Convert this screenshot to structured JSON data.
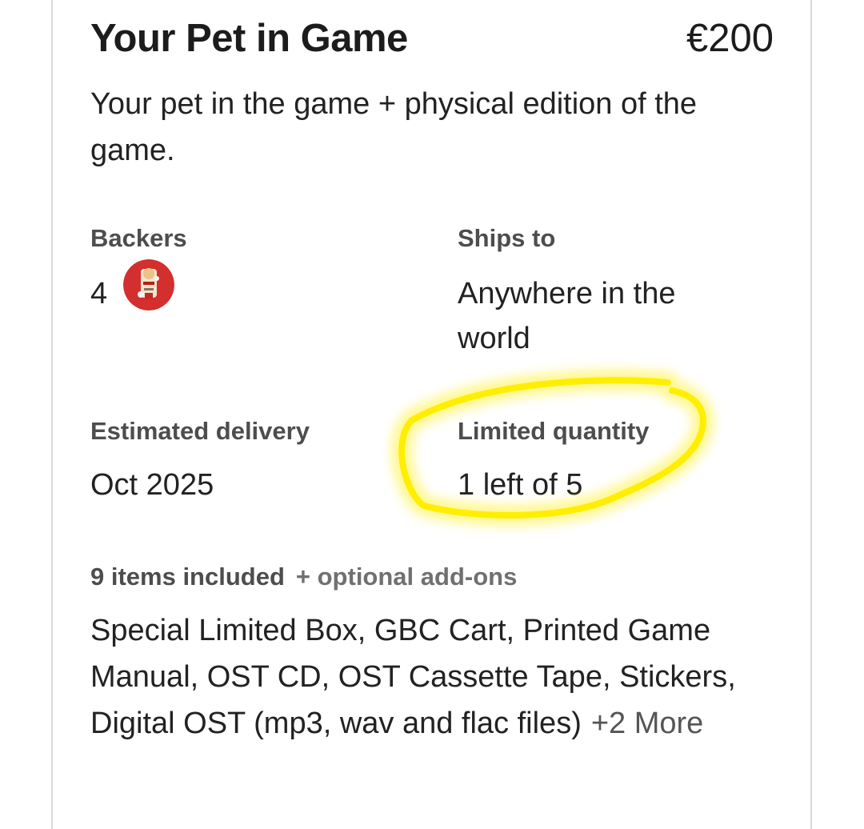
{
  "reward": {
    "title": "Your Pet in Game",
    "price": "€200",
    "description": "Your pet in the game + physical edition of the game."
  },
  "backers": {
    "label": "Backers",
    "count": "4"
  },
  "ships_to": {
    "label": "Ships to",
    "value": "Anywhere in the world"
  },
  "delivery": {
    "label": "Estimated delivery",
    "value": "Oct 2025"
  },
  "limited": {
    "label": "Limited quantity",
    "value": "1 left of 5"
  },
  "items": {
    "label": "9 items included",
    "addons": "+ optional add-ons",
    "list": "Special Limited Box, GBC Cart, Printed Game Manual, OST CD, OST Cassette Tape, Stickers, Digital OST (mp3, wav and flac files)",
    "more": "+2 More"
  },
  "colors": {
    "highlight": "#ffee00",
    "avatar": "#d32f2f"
  }
}
